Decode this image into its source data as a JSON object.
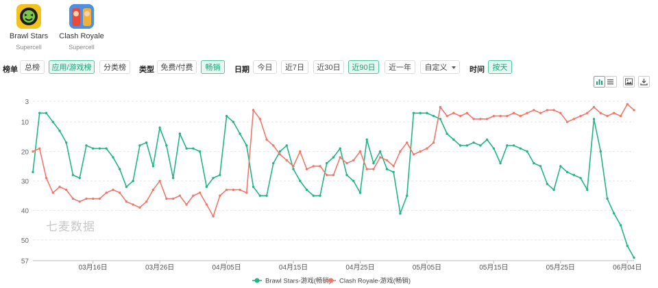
{
  "apps": [
    {
      "name": "Brawl Stars",
      "developer": "Supercell",
      "icon": "brawl-stars-app-icon"
    },
    {
      "name": "Clash Royale",
      "developer": "Supercell",
      "icon": "clash-royale-app-icon"
    }
  ],
  "filters": {
    "rank_label": "榜单",
    "rank_options": [
      "总榜",
      "应用/游戏榜",
      "分类榜"
    ],
    "rank_active": "应用/游戏榜",
    "type_label": "类型",
    "type_options": [
      "免费/付费",
      "畅销"
    ],
    "type_active": "畅销",
    "date_label": "日期",
    "date_options": [
      "今日",
      "近7日",
      "近30日",
      "近90日",
      "近一年"
    ],
    "date_active": "近90日",
    "custom_label": "自定义",
    "time_label": "时间",
    "time_options": [
      "按天"
    ],
    "time_active": "按天"
  },
  "toolbar": {
    "icons": [
      "chart-view-icon",
      "table-view-icon",
      "save-image-icon",
      "download-icon"
    ]
  },
  "watermark": "七麦数据",
  "colors": {
    "brawl": "#20b486",
    "clash": "#f0776b",
    "accent": "#12a57a"
  },
  "chart_data": {
    "type": "line",
    "xlabel": "",
    "ylabel": "",
    "y_inverted": true,
    "y_ticks": [
      3,
      10,
      20,
      30,
      40,
      50,
      57
    ],
    "ylim": [
      3,
      57
    ],
    "x_tick_labels": [
      "03月16日",
      "03月26日",
      "04月05日",
      "04月15日",
      "04月25日",
      "05月05日",
      "05月15日",
      "05月25日",
      "06月04日"
    ],
    "x_start": "03月07日",
    "x_end": "06月04日",
    "legend_position": "bottom-center",
    "series": [
      {
        "name": "Brawl Stars-游戏(畅销)",
        "color": "#20b486",
        "values": [
          27,
          7,
          7,
          10,
          13,
          17,
          28,
          29,
          18,
          19,
          19,
          19,
          22,
          26,
          32,
          30,
          18,
          17,
          25,
          12,
          18,
          29,
          14,
          19,
          19,
          20,
          32,
          29,
          28,
          8,
          10,
          14,
          18,
          32,
          35,
          35,
          24,
          20,
          18,
          26,
          30,
          33,
          35,
          35,
          24,
          22,
          19,
          28,
          30,
          34,
          16,
          24,
          20,
          26,
          27,
          41,
          35,
          7,
          7,
          7,
          8,
          9,
          14,
          16,
          18,
          18,
          17,
          18,
          16,
          19,
          24,
          18,
          18,
          19,
          20,
          24,
          25,
          31,
          33,
          25,
          27,
          28,
          29,
          33,
          9,
          20,
          36,
          41,
          45,
          52,
          56
        ]
      },
      {
        "name": "Clash Royale-游戏(畅销)",
        "color": "#f0776b",
        "values": [
          20,
          19,
          29,
          34,
          32,
          33,
          36,
          37,
          36,
          36,
          36,
          34,
          33,
          34,
          37,
          38,
          39,
          37,
          33,
          30,
          36,
          36,
          35,
          38,
          35,
          34,
          38,
          42,
          35,
          33,
          33,
          33,
          34,
          6,
          9,
          16,
          18,
          21,
          23,
          25,
          20,
          26,
          25,
          25,
          28,
          28,
          22,
          24,
          23,
          20,
          26,
          26,
          22,
          23,
          25,
          20,
          17,
          21,
          20,
          19,
          17,
          5,
          8,
          7,
          8,
          7,
          9,
          9,
          9,
          8,
          8,
          8,
          7,
          8,
          7,
          6,
          7,
          6,
          6,
          7,
          10,
          9,
          8,
          7,
          5,
          7,
          8,
          7,
          8,
          4,
          6
        ]
      }
    ]
  }
}
